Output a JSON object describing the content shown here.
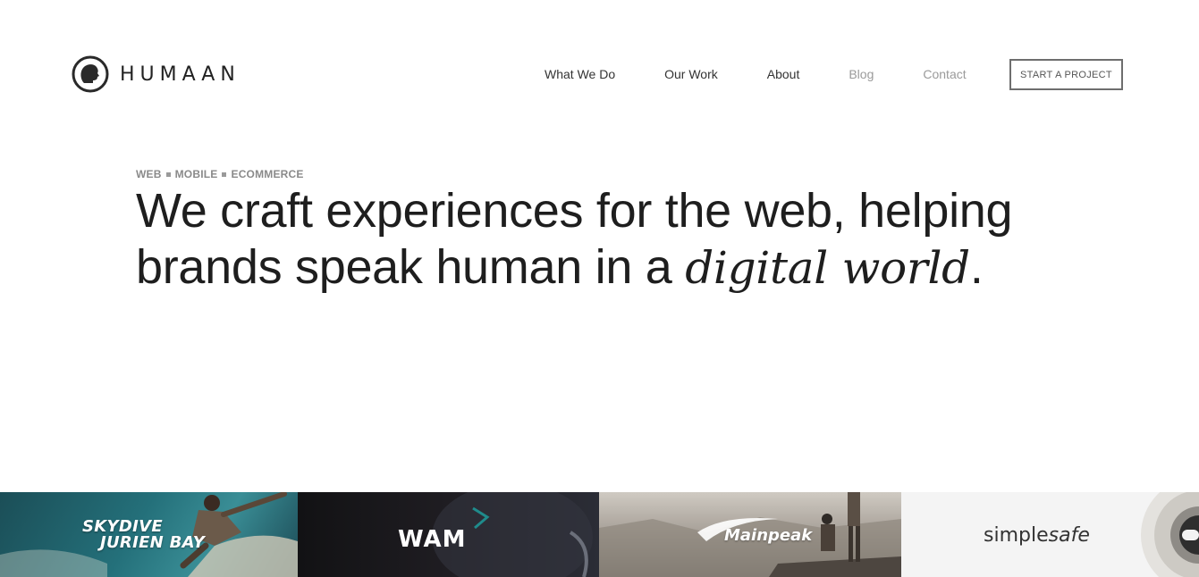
{
  "brand": {
    "name": "HUMAAN",
    "logo_icon": "head-profile-icon"
  },
  "nav": {
    "items": [
      {
        "label": "What We Do",
        "muted": false
      },
      {
        "label": "Our Work",
        "muted": false
      },
      {
        "label": "About",
        "muted": false
      },
      {
        "label": "Blog",
        "muted": true
      },
      {
        "label": "Contact",
        "muted": true
      }
    ],
    "cta": "START A PROJECT"
  },
  "hero": {
    "tags": [
      "WEB",
      "MOBILE",
      "ECOMMERCE"
    ],
    "headline_line1": "We craft experiences for the web, helping",
    "headline_line2_plain": "brands speak human in a ",
    "headline_line2_italic": "digital world",
    "headline_line2_end": "."
  },
  "projects": [
    {
      "line1": "SKYDIVE",
      "line2": "JURIEN BAY"
    },
    {
      "name": "WAM"
    },
    {
      "name": "Mainpeak"
    },
    {
      "name_plain": "simple",
      "name_italic": "safe"
    }
  ],
  "colors": {
    "text": "#222222",
    "muted": "#9a9a9a",
    "cta_border": "#6e6e6e"
  }
}
